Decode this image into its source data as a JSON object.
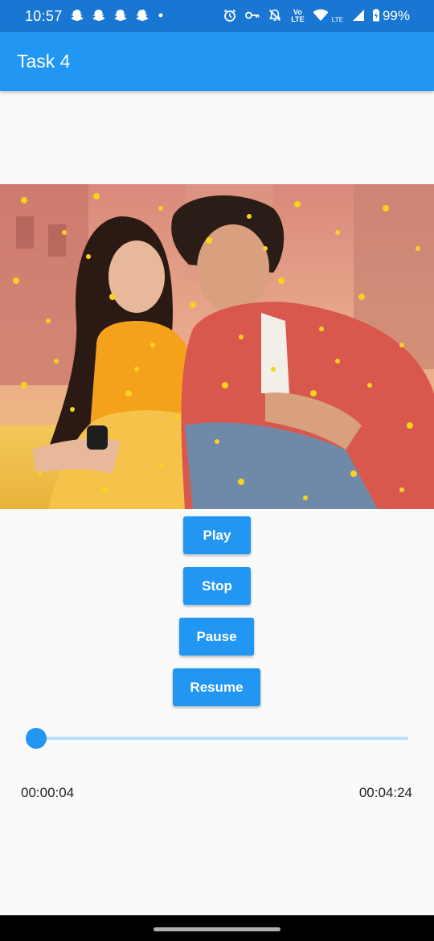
{
  "status_bar": {
    "time": "10:57",
    "left_icons": [
      "snapchat-icon",
      "snapchat-icon",
      "snapchat-icon",
      "snapchat-icon",
      "dot-icon"
    ],
    "volte_label": "Vo LTE",
    "lte_label": "LTE",
    "battery": "99%"
  },
  "app_bar": {
    "title": "Task 4"
  },
  "poster": {
    "subject": "couple-photo",
    "description_colors": [
      "#e8a24a",
      "#f6c928",
      "#c9504a"
    ]
  },
  "controls": {
    "play_label": "Play",
    "stop_label": "Stop",
    "pause_label": "Pause",
    "resume_label": "Resume"
  },
  "player": {
    "position_text": "00:00:04",
    "duration_text": "00:04:24",
    "progress": 0.015
  },
  "colors": {
    "primary": "#2196f3",
    "primary_dark": "#1976d2",
    "track": "#bbdefb"
  }
}
